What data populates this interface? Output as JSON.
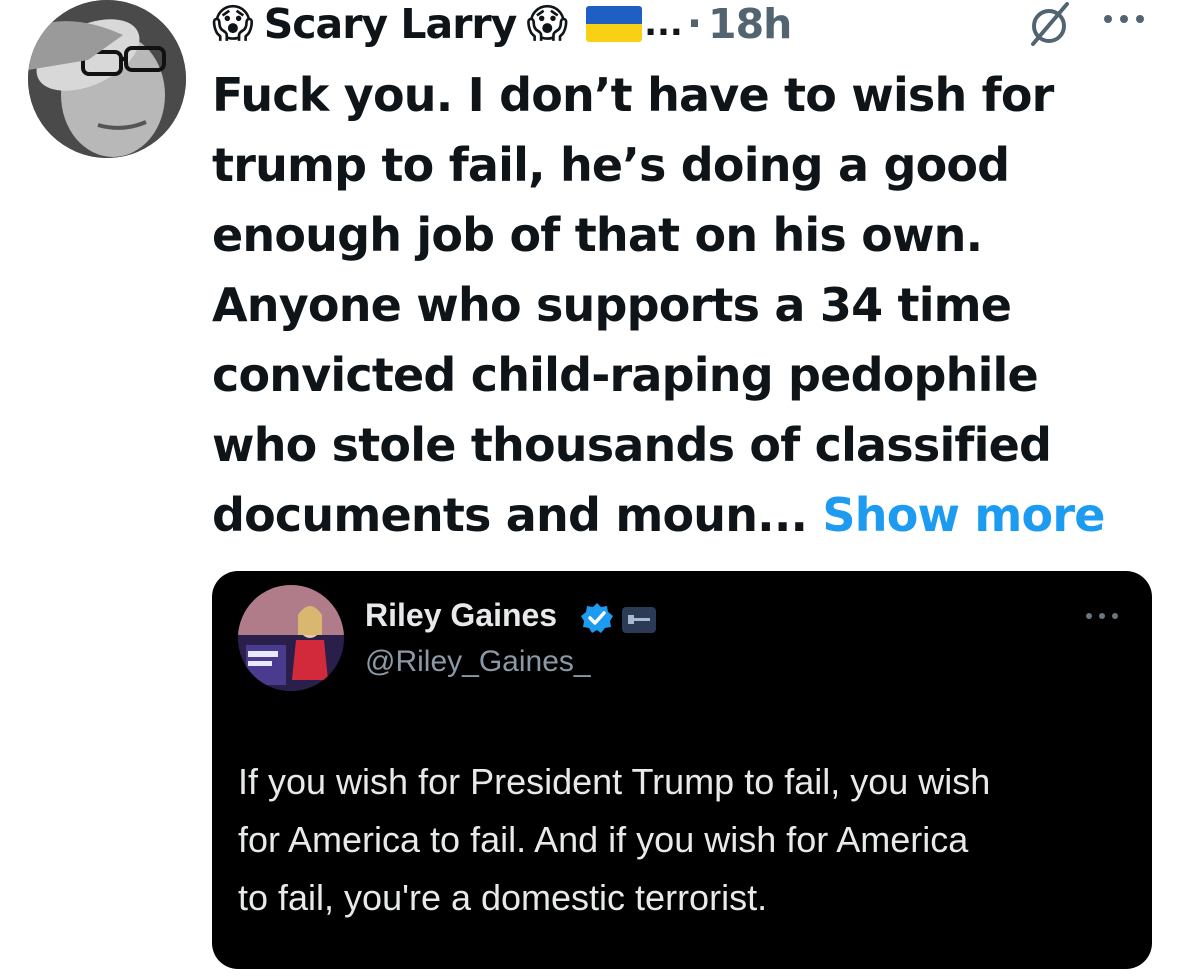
{
  "author": {
    "emoji_left": "😱",
    "display_name": "Scary Larry",
    "emoji_right": "😱",
    "flag_icon": "ukraine-flag-icon",
    "truncation": "...",
    "separator": "·",
    "time": "18h"
  },
  "tweet": {
    "lines": [
      "Fuck you. I don’t have to wish for",
      "trump to fail, he’s doing a good",
      "enough job of that on his own.",
      "Anyone who supports a 34 time",
      "convicted child-raping pedophile",
      "who stole thousands of classified",
      "documents and moun..."
    ],
    "show_more": "Show more"
  },
  "quoted": {
    "name": "Riley Gaines",
    "handle": "@Riley_Gaines_",
    "lines": [
      "If you wish for President Trump to fail, you wish",
      "for America to fail. And if you wish for America",
      "to fail, you're a domestic terrorist."
    ]
  },
  "colors": {
    "link": "#1d9bf0",
    "text": "#0f1419",
    "muted": "#536471",
    "quote_bg": "#000000",
    "verified": "#1d9bf0"
  }
}
